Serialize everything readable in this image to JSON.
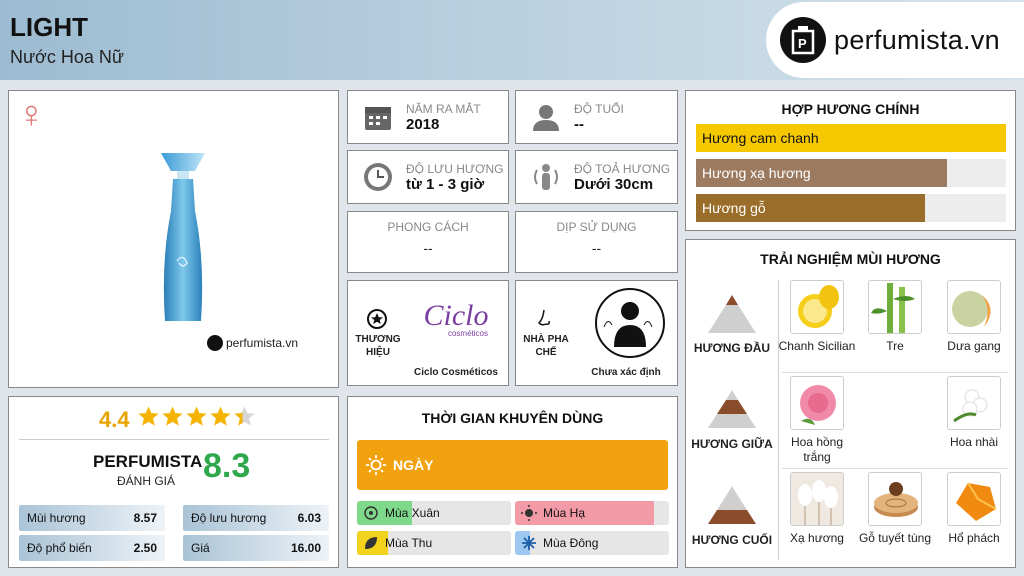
{
  "header": {
    "title": "LIGHT",
    "subtitle": "Nước Hoa Nữ",
    "brand": "perfumista.vn"
  },
  "product": {
    "gender_symbol": "♀",
    "watermark": "perfumista.vn"
  },
  "rating": {
    "score": "4.4",
    "stars": 4.4,
    "label_top": "PERFUMISTA",
    "label_bottom": "ĐÁNH GIÁ",
    "big_score": "8.3",
    "items": [
      {
        "label": "Mùi hương",
        "value": "8.57",
        "level": 0.857
      },
      {
        "label": "Độ lưu hương",
        "value": "6.03",
        "level": 0.603
      },
      {
        "label": "Độ phổ biến",
        "value": "2.50",
        "level": 0.25
      },
      {
        "label": "Giá",
        "value": "16.00",
        "level": 1.0
      }
    ]
  },
  "stats": {
    "year": {
      "label": "NĂM RA MẮT",
      "value": "2018"
    },
    "age": {
      "label": "ĐỘ TUỔI",
      "value": "--"
    },
    "longevity": {
      "label": "ĐỘ LƯU HƯƠNG",
      "value": "từ 1 - 3 giờ"
    },
    "sillage": {
      "label": "ĐỘ TOẢ HƯƠNG",
      "value": "Dưới 30cm"
    },
    "style": {
      "label": "PHONG CÁCH",
      "value": "--"
    },
    "occasion": {
      "label": "DỊP SỬ DỤNG",
      "value": "--"
    }
  },
  "brand": {
    "label": "THƯƠNG HIỆU",
    "logo_text": "Ciclo",
    "logo_sub": "cosméticos",
    "name": "Ciclo Cosméticos"
  },
  "perfumer": {
    "label": "NHÀ PHA CHẾ",
    "name": "Chưa xác định"
  },
  "time_use": {
    "title": "THỜI GIAN KHUYÊN DÙNG",
    "time_label": "NGÀY",
    "seasons": [
      {
        "label": "Mùa Xuân",
        "level": 0.36,
        "color": "#7fd98a"
      },
      {
        "label": "Mùa Hạ",
        "level": 0.9,
        "color": "#f29aa6"
      },
      {
        "label": "Mùa Thu",
        "level": 0.2,
        "color": "#f2d21b"
      },
      {
        "label": "Mùa Đông",
        "level": 0.1,
        "color": "#9cc7f0"
      }
    ]
  },
  "accords": {
    "title": "HỢP HƯƠNG CHÍNH",
    "items": [
      {
        "label": "Hương cam chanh",
        "level": 1.0,
        "color": "#f5c800"
      },
      {
        "label": "Hương xạ hương",
        "level": 0.81,
        "color": "#9b7a5f"
      },
      {
        "label": "Hương gỗ",
        "level": 0.74,
        "color": "#9b6d2a"
      }
    ]
  },
  "notes": {
    "title": "TRẢI NGHIỆM MÙI HƯƠNG",
    "top": {
      "label": "HƯƠNG ĐẦU",
      "items": [
        "Chanh Sicilian",
        "Tre",
        "Dưa gang"
      ]
    },
    "middle": {
      "label": "HƯƠNG GIỮA",
      "items": [
        "Hoa hồng trắng",
        "Hoa nhài"
      ]
    },
    "base": {
      "label": "HƯƠNG CUỐI",
      "items": [
        "Xạ hương",
        "Gỗ tuyết tùng",
        "Hổ phách"
      ]
    }
  }
}
